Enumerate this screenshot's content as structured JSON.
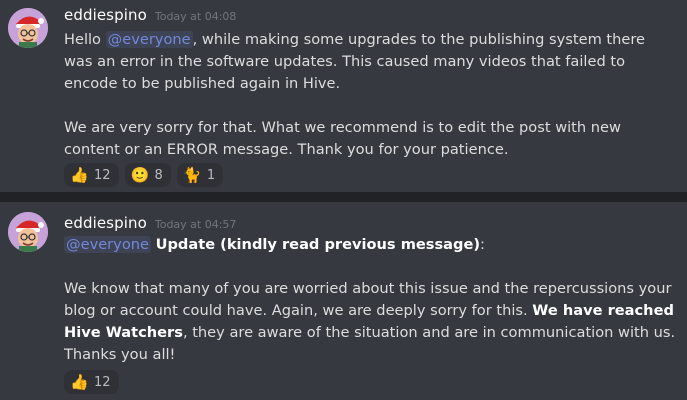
{
  "messages": [
    {
      "username": "eddiespino",
      "timestamp": "Today at 04:08",
      "paragraphs": {
        "p1_prefix": "Hello ",
        "p1_mention": "@everyone",
        "p1_suffix": ", while making some upgrades to the publishing system there was an error in the software updates. This caused many videos that failed to encode to be published again in Hive.",
        "p2": "We are very sorry for that. What we recommend is to edit the post with new content or an ERROR message. Thank you for your patience."
      },
      "reactions": [
        {
          "emoji": "👍",
          "icon": "thumbs-up",
          "count": "12"
        },
        {
          "emoji": "🙂",
          "icon": "slightly-smiling-face",
          "count": "8"
        },
        {
          "emoji": "🐈",
          "icon": "cat",
          "count": "1"
        }
      ]
    },
    {
      "username": "eddiespino",
      "timestamp": "Today at 04:57",
      "paragraphs": {
        "p1_mention": "@everyone",
        "p1_bold": "Update (kindly read previous  message)",
        "p1_suffix": ":",
        "p2_prefix": "We know that many of you are worried about this issue and the repercussions your blog or account could have. Again, we are deeply sorry for this. ",
        "p2_bold": "We have reached Hive Watchers",
        "p2_suffix": ", they are aware of the situation and are in communication with us. Thanks you all!"
      },
      "reactions": [
        {
          "emoji": "👍",
          "icon": "thumbs-up",
          "count": "12"
        }
      ]
    }
  ],
  "colors": {
    "background": "#36393f",
    "mention": "#7289da",
    "timestamp": "#72767d",
    "reaction_bg": "#2f3136"
  }
}
